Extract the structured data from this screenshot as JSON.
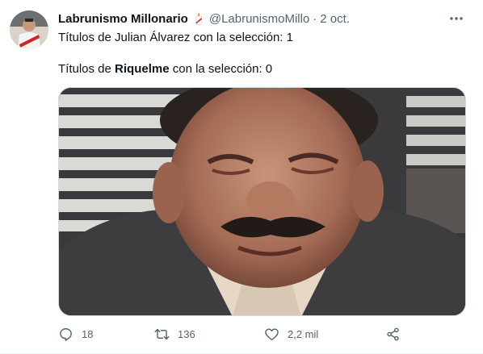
{
  "tweet": {
    "author_name": "Labrunismo Millonario",
    "handle": "@LabrunismoMillo",
    "separator": "·",
    "date": "2 oct.",
    "line1": "Títulos de Julian Álvarez con la selección: 1",
    "line2_prefix": "Títulos de ",
    "line2_bold": "Riquelme",
    "line2_suffix": " con la selección: 0",
    "icons": {
      "more": "more-dots-icon",
      "badge": "river-badge-icon"
    }
  },
  "actions": {
    "reply_count": "18",
    "retweet_count": "136",
    "like_count": "2,2 mil",
    "icons": [
      "reply-icon",
      "retweet-icon",
      "like-icon",
      "share-icon"
    ]
  },
  "colors": {
    "text": "#0f1419",
    "secondary": "#536471",
    "border": "#cfd9de"
  }
}
